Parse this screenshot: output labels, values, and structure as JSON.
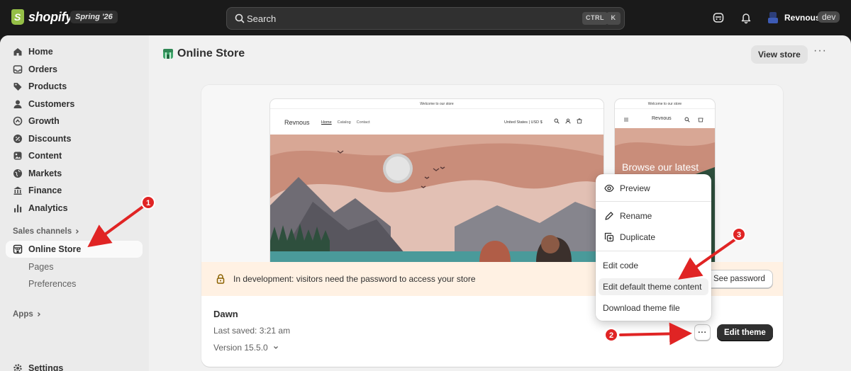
{
  "topbar": {
    "logo_text": "shopify",
    "edition": "Spring '26",
    "search_placeholder": "Search",
    "shortcut_ctrl": "CTRL",
    "shortcut_k": "K",
    "user_name": "Revnous",
    "user_badge": "dev"
  },
  "sidebar": {
    "items": [
      {
        "label": "Home",
        "icon": "home-icon"
      },
      {
        "label": "Orders",
        "icon": "inbox-icon"
      },
      {
        "label": "Products",
        "icon": "tag-icon"
      },
      {
        "label": "Customers",
        "icon": "person-icon"
      },
      {
        "label": "Growth",
        "icon": "growth-icon"
      },
      {
        "label": "Discounts",
        "icon": "discount-icon"
      },
      {
        "label": "Content",
        "icon": "content-icon"
      },
      {
        "label": "Markets",
        "icon": "globe-icon"
      },
      {
        "label": "Finance",
        "icon": "bank-icon"
      },
      {
        "label": "Analytics",
        "icon": "bar-chart-icon"
      }
    ],
    "sales_channels_label": "Sales channels",
    "online_store_label": "Online Store",
    "sub_items": [
      "Pages",
      "Preferences"
    ],
    "apps_label": "Apps",
    "settings_label": "Settings"
  },
  "header": {
    "title": "Online Store",
    "view_store": "View store",
    "more": "···"
  },
  "preview": {
    "announcement": "Welcome to our store",
    "brand": "Revnous",
    "nav": [
      "Home",
      "Catalog",
      "Contact"
    ],
    "region": "United States | USD $",
    "mobile_hero_text": "Browse our latest"
  },
  "banner": {
    "text": "In development: visitors need the password to access your store",
    "button": "See password"
  },
  "theme": {
    "name": "Dawn",
    "last_saved": "Last saved: 3:21 am",
    "version": "Version 15.5.0",
    "more_button": "···",
    "edit_button": "Edit theme"
  },
  "menu": {
    "preview": "Preview",
    "rename": "Rename",
    "duplicate": "Duplicate",
    "edit_code": "Edit code",
    "edit_default": "Edit default theme content",
    "download": "Download theme file"
  },
  "annotations": {
    "badge_1": "1",
    "badge_2": "2",
    "badge_3": "3",
    "color": "#e02424"
  },
  "colors": {
    "topbar": "#1a1a1a",
    "page_bg": "#f1f1f1",
    "sidebar_bg": "#ebebeb",
    "banner_bg": "#fff1e3",
    "primary_button": "#303030",
    "brand_green": "#95bf47"
  }
}
